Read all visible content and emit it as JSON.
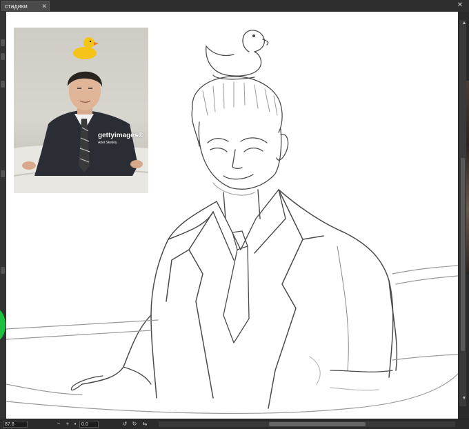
{
  "tab": {
    "label": "стадики",
    "close_glyph": "✕"
  },
  "window": {
    "close_glyph": "✕"
  },
  "reference": {
    "watermark": "gettyimages®",
    "credit": "Ariel Skelley"
  },
  "status": {
    "zoom": "87.8",
    "minus": "−",
    "plus": "+",
    "fit": "▪",
    "angle": "0.0"
  },
  "colors": {
    "accent_green": "#1fbf3f",
    "canvas": "#ffffff",
    "chrome": "#3c3c3c"
  }
}
